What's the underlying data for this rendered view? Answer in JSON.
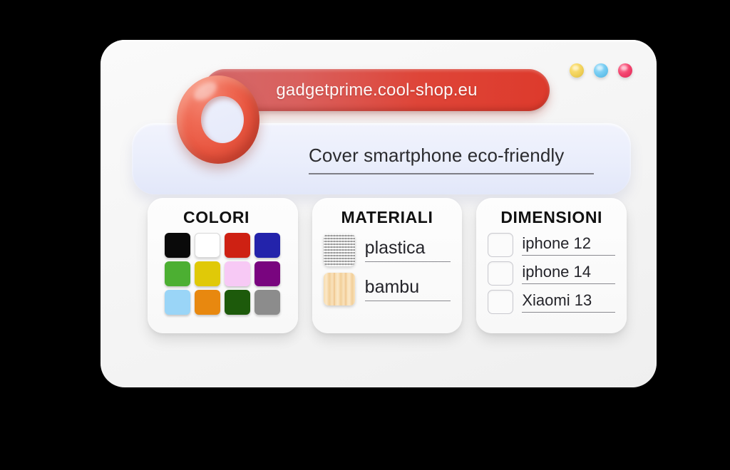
{
  "window": {
    "url": "gadgetprime.cool-shop.eu",
    "controls": [
      {
        "name": "window-dot-yellow",
        "color": "#f3d45e"
      },
      {
        "name": "window-dot-blue",
        "color": "#74cbf2"
      },
      {
        "name": "window-dot-pink",
        "color": "#f3436d"
      }
    ]
  },
  "search": {
    "query": "Cover smartphone eco-friendly",
    "icon": "magnifier-icon"
  },
  "panels": [
    {
      "id": "colori",
      "title": "COLORI",
      "swatches": [
        {
          "label": "nero",
          "color": "#0a0a0a"
        },
        {
          "label": "bianco",
          "color": "#ffffff"
        },
        {
          "label": "rosso",
          "color": "#ce2113"
        },
        {
          "label": "blu",
          "color": "#2323ab"
        },
        {
          "label": "verde",
          "color": "#4caf32"
        },
        {
          "label": "giallo",
          "color": "#e0c908"
        },
        {
          "label": "rosa",
          "color": "#f7c9f5"
        },
        {
          "label": "viola",
          "color": "#79057f"
        },
        {
          "label": "azzurro",
          "color": "#9ad5f7"
        },
        {
          "label": "arancione",
          "color": "#e8880f"
        },
        {
          "label": "verde scuro",
          "color": "#1d5a0b"
        },
        {
          "label": "grigio",
          "color": "#8c8c8c"
        }
      ]
    },
    {
      "id": "materiali",
      "title": "MATERIALI",
      "options": [
        {
          "label": "plastica",
          "swatch": "plastic-texture-swatch"
        },
        {
          "label": "bambu",
          "swatch": "bamboo-texture-swatch"
        }
      ]
    },
    {
      "id": "dimensioni",
      "title": "DIMENSIONI",
      "options": [
        {
          "label": "iphone 12",
          "checked": false
        },
        {
          "label": "iphone 14",
          "checked": false
        },
        {
          "label": "Xiaomi 13",
          "checked": false
        }
      ]
    }
  ]
}
